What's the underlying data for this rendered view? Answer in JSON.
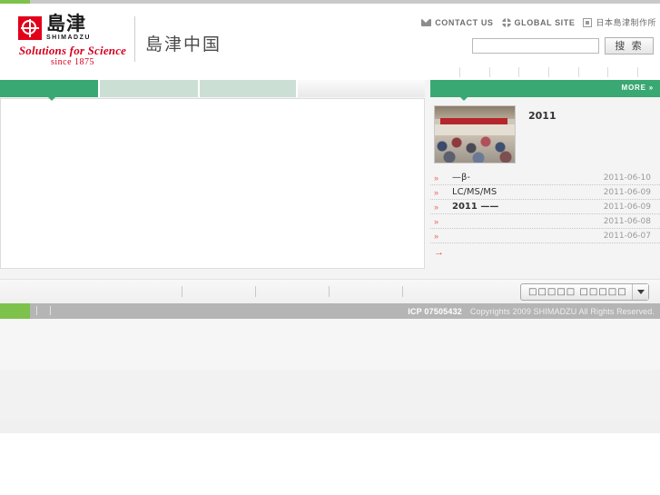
{
  "header": {
    "logo": {
      "kanji": "島津",
      "wordmark": "SHIMADZU",
      "tagline": "Solutions for Science",
      "since": "since 1875"
    },
    "site_name": "島津中国",
    "util_links": [
      {
        "label": "CONTACT US",
        "icon": "mail-icon"
      },
      {
        "label": "GLOBAL SITE",
        "icon": "globe-icon"
      },
      {
        "label": "日本島津制作所",
        "icon": "jp-site-icon"
      }
    ],
    "search": {
      "value": "",
      "placeholder": "",
      "button_label": "搜 索"
    },
    "nav_items": [
      {
        "label": ""
      },
      {
        "label": ""
      },
      {
        "label": ""
      },
      {
        "label": ""
      },
      {
        "label": ""
      },
      {
        "label": ""
      },
      {
        "label": ""
      },
      {
        "label": ""
      }
    ]
  },
  "main": {
    "tabs": [
      {
        "label": "",
        "active": true
      },
      {
        "label": "",
        "active": false
      },
      {
        "label": "",
        "active": false
      }
    ],
    "panel_content": ""
  },
  "news": {
    "more_label": "MORE »",
    "feature": {
      "title": "2011",
      "thumb_alt": "conference-audience-photo"
    },
    "items": [
      {
        "bullet": "»",
        "text": "—β-",
        "date": "2011-06-10",
        "bold": false
      },
      {
        "bullet": "»",
        "text": "LC/MS/MS",
        "date": "2011-06-09",
        "bold": false
      },
      {
        "bullet": "»",
        "text": "2011          ——",
        "date": "2011-06-09",
        "bold": true
      },
      {
        "bullet": "»",
        "text": "",
        "date": "2011-06-08",
        "bold": false
      },
      {
        "bullet": "»",
        "text": "",
        "date": "2011-06-07",
        "bold": false
      }
    ],
    "arrow": "→"
  },
  "footer": {
    "links": [
      {
        "label": ""
      },
      {
        "label": ""
      },
      {
        "label": ""
      },
      {
        "label": ""
      },
      {
        "label": ""
      }
    ],
    "language_select": {
      "value": "□□□□□   □□□□□",
      "caret": "▼"
    },
    "mini_links": [
      {
        "label": ""
      },
      {
        "label": ""
      }
    ],
    "icp": "ICP 07505432",
    "copyright": "Copyrights 2009 SHIMADZU All Rights Reserved."
  },
  "colors": {
    "brand_green": "#3aa873",
    "accent_green": "#7dc24a",
    "logo_red": "#e2001a",
    "tab_inactive": "#ccdfd5",
    "footer_gray": "#b5b5b5"
  }
}
